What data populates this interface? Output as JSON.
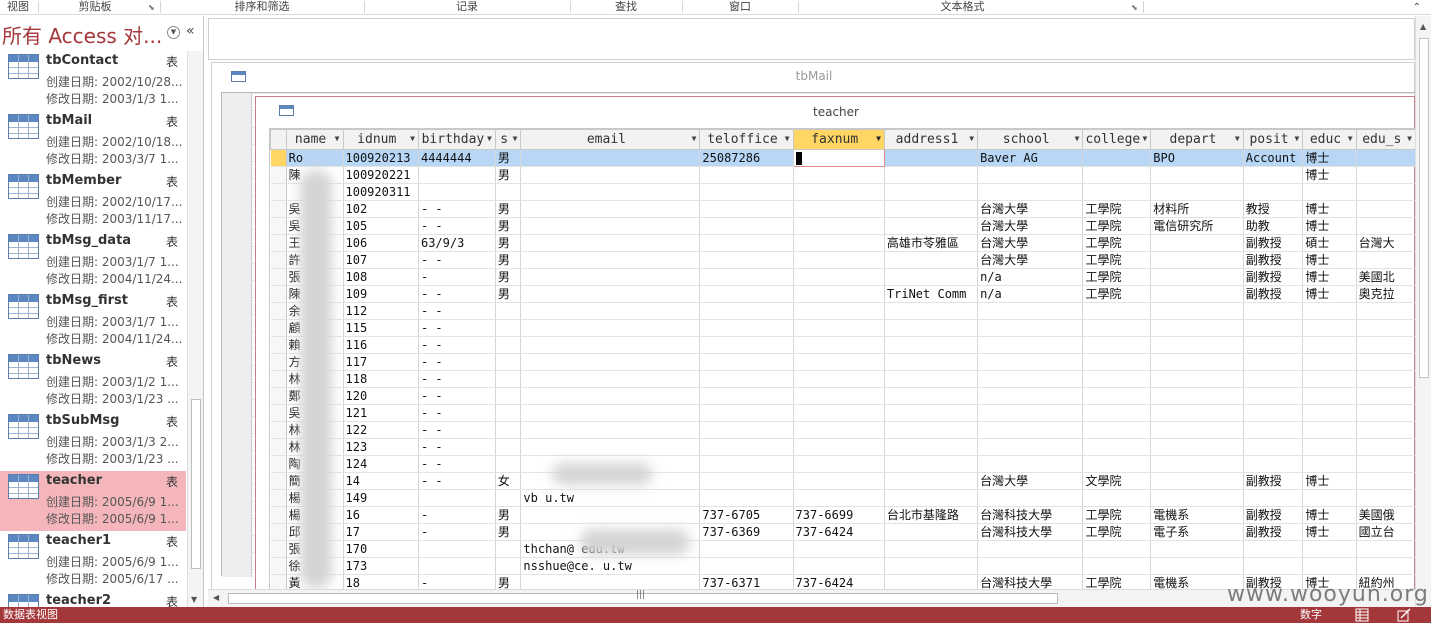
{
  "ribbon": {
    "groups": [
      "视图",
      "剪贴板",
      "排序和筛选",
      "记录",
      "查找",
      "窗口",
      "文本格式"
    ]
  },
  "nav": {
    "title": "所有 Access 对...",
    "items": [
      {
        "name": "tbContact",
        "type": "表",
        "created": "创建日期: 2002/10/28...",
        "modified": "修改日期: 2003/1/3 1..."
      },
      {
        "name": "tbMail",
        "type": "表",
        "created": "创建日期: 2002/10/18...",
        "modified": "修改日期: 2003/3/7 1..."
      },
      {
        "name": "tbMember",
        "type": "表",
        "created": "创建日期: 2002/10/17...",
        "modified": "修改日期: 2003/11/17..."
      },
      {
        "name": "tbMsg_data",
        "type": "表",
        "created": "创建日期: 2003/1/7 1...",
        "modified": "修改日期: 2004/11/24..."
      },
      {
        "name": "tbMsg_first",
        "type": "表",
        "created": "创建日期: 2003/1/7 1...",
        "modified": "修改日期: 2004/11/24..."
      },
      {
        "name": "tbNews",
        "type": "表",
        "created": "创建日期: 2003/1/2 1...",
        "modified": "修改日期: 2003/1/23 ..."
      },
      {
        "name": "tbSubMsg",
        "type": "表",
        "created": "创建日期: 2003/1/3 2...",
        "modified": "修改日期: 2003/1/23 ..."
      },
      {
        "name": "teacher",
        "type": "表",
        "created": "创建日期: 2005/6/9 1...",
        "modified": "修改日期: 2005/6/9 1...",
        "selected": true
      },
      {
        "name": "teacher1",
        "type": "表",
        "created": "创建日期: 2005/6/9 1...",
        "modified": "修改日期: 2005/6/17 ..."
      },
      {
        "name": "teacher2",
        "type": "表",
        "created": "",
        "modified": ""
      }
    ]
  },
  "windows": {
    "mail_title": "tbMail",
    "teacher_title": "teacher"
  },
  "grid": {
    "columns": [
      "name",
      "idnum",
      "birthday",
      "s",
      "email",
      "teloffice",
      "faxnum",
      "address1",
      "school",
      "college",
      "depart",
      "posit",
      "educ",
      "edu_s"
    ],
    "selected_column": "faxnum",
    "rows": [
      [
        "Ro",
        "100920213",
        "4444444",
        "男",
        "",
        "25087286",
        "",
        "",
        "Baver AG",
        "",
        "BPO",
        "Account",
        "博士",
        ""
      ],
      [
        "陳",
        "100920221",
        "",
        "男",
        "",
        "",
        "",
        "",
        "",
        "",
        "",
        "",
        "博士",
        ""
      ],
      [
        "",
        "100920311",
        "",
        "",
        "",
        "",
        "",
        "",
        "",
        "",
        "",
        "",
        "",
        ""
      ],
      [
        "吳",
        "102",
        "-  -",
        "男",
        "",
        "",
        "",
        "",
        "台灣大學",
        "工學院",
        "材料所",
        "教授",
        "博士",
        ""
      ],
      [
        "吳",
        "105",
        "-  -",
        "男",
        "",
        "",
        "",
        "",
        "台灣大學",
        "工學院",
        "電信研究所",
        "助教",
        "博士",
        ""
      ],
      [
        "王",
        "106",
        "63/9/3",
        "男",
        "",
        "",
        "",
        "高雄市苓雅區",
        "台灣大學",
        "工學院",
        "",
        "副教授",
        "碩士",
        "台灣大"
      ],
      [
        "許",
        "107",
        "-  -",
        "男",
        "",
        "",
        "",
        "",
        "台灣大學",
        "工學院",
        "",
        "副教授",
        "博士",
        ""
      ],
      [
        "張",
        "108",
        "-",
        "男",
        "",
        "",
        "",
        "",
        "n/a",
        "工學院",
        "",
        "副教授",
        "博士",
        "美國北"
      ],
      [
        "陳",
        "109",
        "-  -",
        "男",
        "",
        "",
        "",
        "TriNet Comm",
        "n/a",
        "工學院",
        "",
        "副教授",
        "博士",
        "奧克拉"
      ],
      [
        "余",
        "112",
        "-  -",
        "",
        "",
        "",
        "",
        "",
        "",
        "",
        "",
        "",
        "",
        ""
      ],
      [
        "顧",
        "115",
        "-  -",
        "",
        "",
        "",
        "",
        "",
        "",
        "",
        "",
        "",
        "",
        ""
      ],
      [
        "賴",
        "116",
        "-  -",
        "",
        "",
        "",
        "",
        "",
        "",
        "",
        "",
        "",
        "",
        ""
      ],
      [
        "方",
        "117",
        "-  -",
        "",
        "",
        "",
        "",
        "",
        "",
        "",
        "",
        "",
        "",
        ""
      ],
      [
        "林",
        "118",
        "-  -",
        "",
        "",
        "",
        "",
        "",
        "",
        "",
        "",
        "",
        "",
        ""
      ],
      [
        "鄭",
        "120",
        "-  -",
        "",
        "",
        "",
        "",
        "",
        "",
        "",
        "",
        "",
        "",
        ""
      ],
      [
        "吳",
        "121",
        "-  -",
        "",
        "",
        "",
        "",
        "",
        "",
        "",
        "",
        "",
        "",
        ""
      ],
      [
        "林",
        "122",
        "-  -",
        "",
        "",
        "",
        "",
        "",
        "",
        "",
        "",
        "",
        "",
        ""
      ],
      [
        "林",
        "123",
        "-  -",
        "",
        "",
        "",
        "",
        "",
        "",
        "",
        "",
        "",
        "",
        ""
      ],
      [
        "陶",
        "124",
        "-  -",
        "",
        "",
        "",
        "",
        "",
        "",
        "",
        "",
        "",
        "",
        ""
      ],
      [
        "簡",
        "14",
        "-  -",
        "女",
        "",
        "",
        "",
        "",
        "台灣大學",
        "文學院",
        "",
        "副教授",
        "博士",
        ""
      ],
      [
        "楊",
        "149",
        "",
        "",
        "vb              u.tw",
        "",
        "",
        "",
        "",
        "",
        "",
        "",
        "",
        ""
      ],
      [
        "楊",
        "16",
        "-",
        "男",
        "",
        "737-6705",
        "737-6699",
        "台北市基隆路",
        "台灣科技大學",
        "工學院",
        "電機系",
        "副教授",
        "博士",
        "美國俄"
      ],
      [
        "邱",
        "17",
        "-",
        "男",
        "",
        "737-6369",
        "737-6424",
        "",
        "台灣科技大學",
        "工學院",
        "電子系",
        "副教授",
        "博士",
        "國立台"
      ],
      [
        "張",
        "170",
        "",
        "",
        "thchan@        edu.tw",
        "",
        "",
        "",
        "",
        "",
        "",
        "",
        "",
        ""
      ],
      [
        "徐",
        "173",
        "",
        "",
        "nsshue@ce.     u.tw",
        "",
        "",
        "",
        "",
        "",
        "",
        "",
        "",
        ""
      ],
      [
        "黃",
        "18",
        "-",
        "男",
        "",
        "737-6371",
        "737-6424",
        "",
        "台灣科技大學",
        "工學院",
        "電機系",
        "副教授",
        "博士",
        "紐約州"
      ]
    ]
  },
  "status": {
    "view_text": "数据表视图",
    "numlock": "数字"
  },
  "watermark": "www.wooyun.org",
  "colors": {
    "accent": "#a4373a",
    "selected_nav": "#f4b6bb",
    "current_row": "#b8d6f5",
    "selected_header": "#ffd663"
  }
}
